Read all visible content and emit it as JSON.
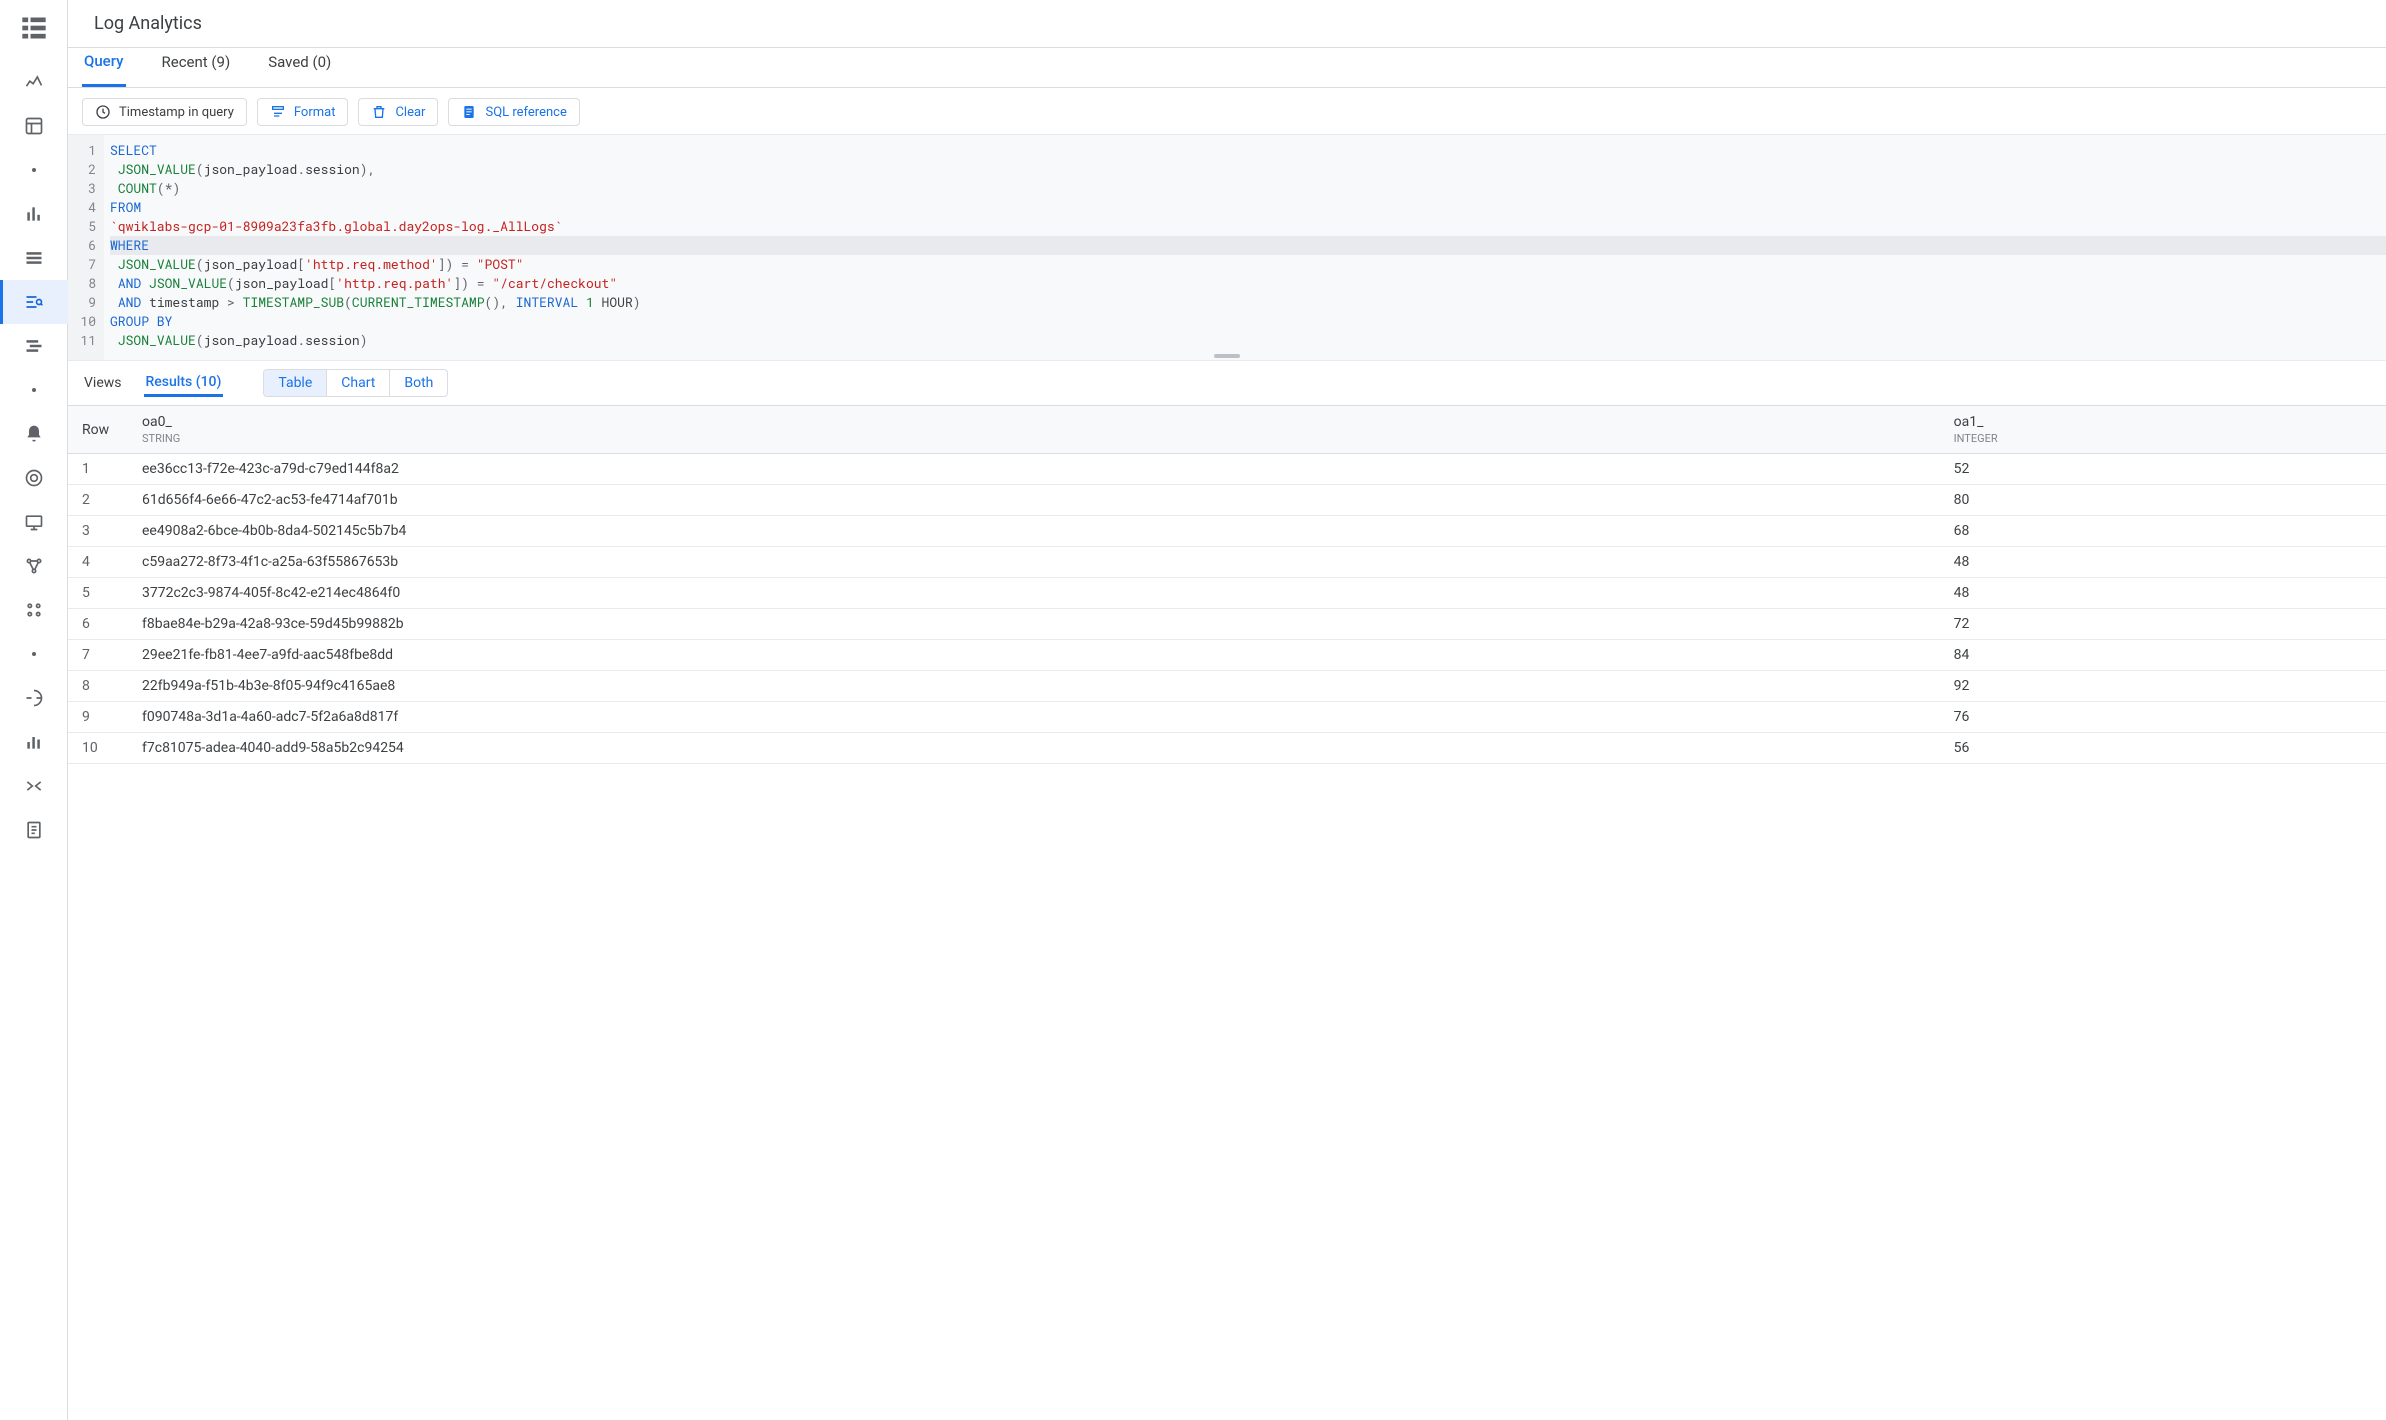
{
  "page_title": "Log Analytics",
  "top_tabs": [
    {
      "label": "Query",
      "active": true
    },
    {
      "label": "Recent (9)",
      "active": false
    },
    {
      "label": "Saved (0)",
      "active": false
    }
  ],
  "toolbar": {
    "timestamp_label": "Timestamp in query",
    "format_label": "Format",
    "clear_label": "Clear",
    "sql_ref_label": "SQL reference"
  },
  "query_lines": [
    [
      {
        "t": "SELECT",
        "c": "k"
      }
    ],
    [
      {
        "t": " ",
        "c": ""
      },
      {
        "t": "JSON_VALUE",
        "c": "f"
      },
      {
        "t": "(",
        "c": "p"
      },
      {
        "t": "json_payload",
        "c": "id"
      },
      {
        "t": ".",
        "c": "p"
      },
      {
        "t": "session",
        "c": "id"
      },
      {
        "t": "),",
        "c": "p"
      }
    ],
    [
      {
        "t": " ",
        "c": ""
      },
      {
        "t": "COUNT",
        "c": "f"
      },
      {
        "t": "(",
        "c": "p"
      },
      {
        "t": "*",
        "c": "p"
      },
      {
        "t": ")",
        "c": "p"
      }
    ],
    [
      {
        "t": "FROM",
        "c": "k"
      }
    ],
    [
      {
        "t": "`qwiklabs-gcp-01-8909a23fa3fb.global.day2ops-log._AllLogs`",
        "c": "s"
      }
    ],
    [
      {
        "t": "WHERE",
        "c": "k"
      }
    ],
    [
      {
        "t": " ",
        "c": ""
      },
      {
        "t": "JSON_VALUE",
        "c": "f"
      },
      {
        "t": "(",
        "c": "p"
      },
      {
        "t": "json_payload",
        "c": "id"
      },
      {
        "t": "[",
        "c": "p"
      },
      {
        "t": "'http.req.method'",
        "c": "s"
      },
      {
        "t": "])",
        "c": "p"
      },
      {
        "t": " = ",
        "c": "p"
      },
      {
        "t": "\"POST\"",
        "c": "s"
      }
    ],
    [
      {
        "t": " ",
        "c": ""
      },
      {
        "t": "AND",
        "c": "k"
      },
      {
        "t": " ",
        "c": ""
      },
      {
        "t": "JSON_VALUE",
        "c": "f"
      },
      {
        "t": "(",
        "c": "p"
      },
      {
        "t": "json_payload",
        "c": "id"
      },
      {
        "t": "[",
        "c": "p"
      },
      {
        "t": "'http.req.path'",
        "c": "s"
      },
      {
        "t": "])",
        "c": "p"
      },
      {
        "t": " = ",
        "c": "p"
      },
      {
        "t": "\"/cart/checkout\"",
        "c": "s"
      }
    ],
    [
      {
        "t": " ",
        "c": ""
      },
      {
        "t": "AND",
        "c": "k"
      },
      {
        "t": " ",
        "c": ""
      },
      {
        "t": "timestamp",
        "c": "id"
      },
      {
        "t": " > ",
        "c": "p"
      },
      {
        "t": "TIMESTAMP_SUB",
        "c": "f"
      },
      {
        "t": "(",
        "c": "p"
      },
      {
        "t": "CURRENT_TIMESTAMP",
        "c": "f"
      },
      {
        "t": "(),",
        "c": "p"
      },
      {
        "t": " INTERVAL ",
        "c": "k"
      },
      {
        "t": "1",
        "c": "n"
      },
      {
        "t": " HOUR",
        "c": "id"
      },
      {
        "t": ")",
        "c": "p"
      }
    ],
    [
      {
        "t": "GROUP BY",
        "c": "k"
      }
    ],
    [
      {
        "t": " ",
        "c": ""
      },
      {
        "t": "JSON_VALUE",
        "c": "f"
      },
      {
        "t": "(",
        "c": "p"
      },
      {
        "t": "json_payload",
        "c": "id"
      },
      {
        "t": ".",
        "c": "p"
      },
      {
        "t": "session",
        "c": "id"
      },
      {
        "t": ")",
        "c": "p"
      }
    ]
  ],
  "highlight_line_index": 5,
  "results_tabs": {
    "views_label": "Views",
    "results_label": "Results (10)"
  },
  "view_segments": [
    {
      "label": "Table",
      "active": true
    },
    {
      "label": "Chart",
      "active": false
    },
    {
      "label": "Both",
      "active": false
    }
  ],
  "table": {
    "row_header": "Row",
    "columns": [
      {
        "name": "oa0_",
        "type": "STRING"
      },
      {
        "name": "oa1_",
        "type": "INTEGER"
      }
    ],
    "rows": [
      {
        "n": 1,
        "c0": "ee36cc13-f72e-423c-a79d-c79ed144f8a2",
        "c1": "52"
      },
      {
        "n": 2,
        "c0": "61d656f4-6e66-47c2-ac53-fe4714af701b",
        "c1": "80"
      },
      {
        "n": 3,
        "c0": "ee4908a2-6bce-4b0b-8da4-502145c5b7b4",
        "c1": "68"
      },
      {
        "n": 4,
        "c0": "c59aa272-8f73-4f1c-a25a-63f55867653b",
        "c1": "48"
      },
      {
        "n": 5,
        "c0": "3772c2c3-9874-405f-8c42-e214ec4864f0",
        "c1": "48"
      },
      {
        "n": 6,
        "c0": "f8bae84e-b29a-42a8-93ce-59d45b99882b",
        "c1": "72"
      },
      {
        "n": 7,
        "c0": "29ee21fe-fb81-4ee7-a9fd-aac548fbe8dd",
        "c1": "84"
      },
      {
        "n": 8,
        "c0": "22fb949a-f51b-4b3e-8f05-94f9c4165ae8",
        "c1": "92"
      },
      {
        "n": 9,
        "c0": "f090748a-3d1a-4a60-adc7-5f2a6a8d817f",
        "c1": "76"
      },
      {
        "n": 10,
        "c0": "f7c81075-adea-4040-add9-58a5b2c94254",
        "c1": "56"
      }
    ]
  }
}
